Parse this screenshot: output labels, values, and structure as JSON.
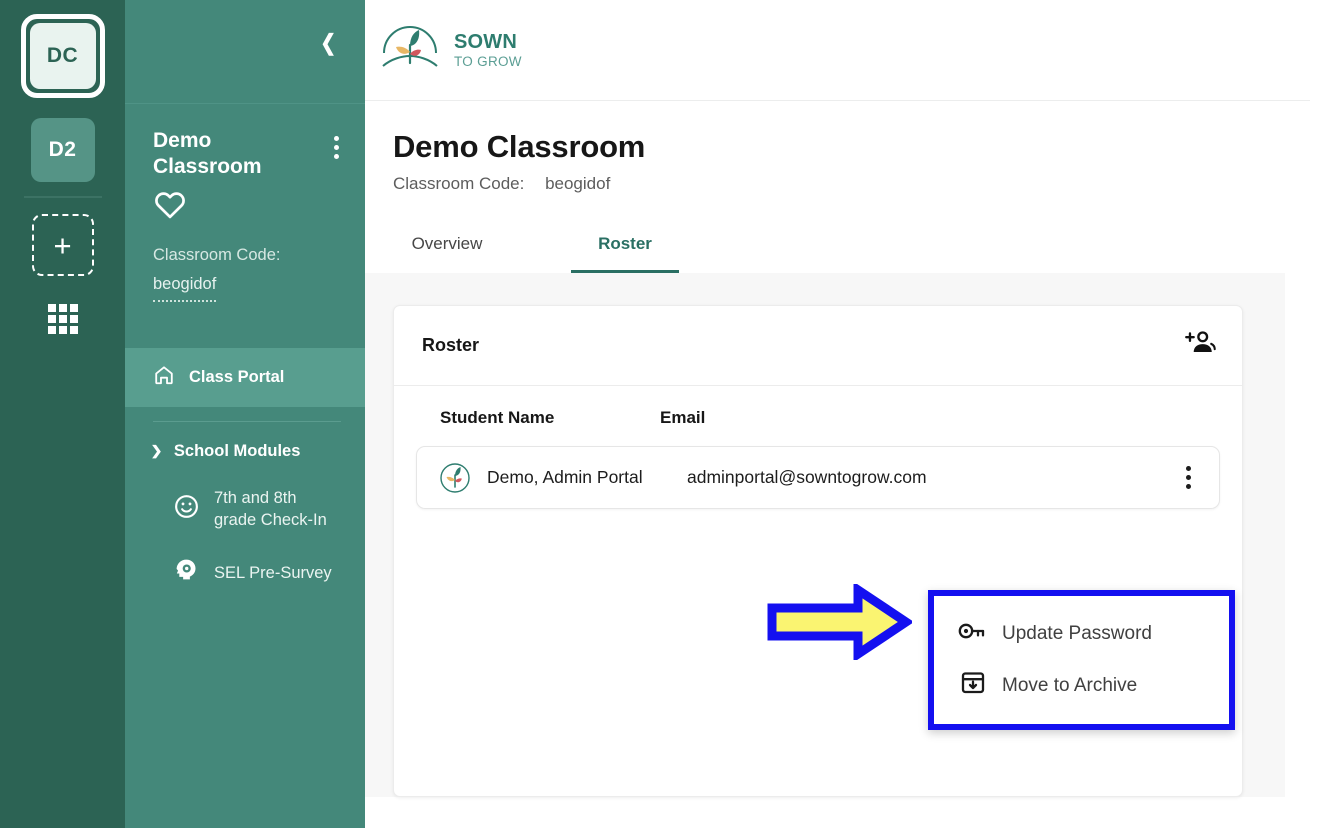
{
  "rail": {
    "avatar_primary": "DC",
    "avatar_secondary": "D2",
    "add_label": "+",
    "grid_icon": "grid-apps-icon"
  },
  "class_panel": {
    "collapse_icon": "chevron-left-icon",
    "title": "Demo Classroom",
    "kebab_icon": "kebab-menu-icon",
    "favorite_icon": "heart-outline-icon",
    "code_label": "Classroom Code:",
    "code_value": "beogidof",
    "nav": [
      {
        "label": "Class Portal",
        "icon": "home-icon",
        "active": true
      }
    ],
    "group": {
      "label": "School Modules",
      "icon": "chevron-down-icon",
      "expanded": true
    },
    "modules": [
      {
        "label": "7th and 8th grade Check-In",
        "icon": "smiley-face-icon"
      },
      {
        "label": "SEL Pre-Survey",
        "icon": "head-gear-icon"
      }
    ]
  },
  "topbar": {
    "logo_icon": "sown-to-grow-logo",
    "logo_line1": "SOWN",
    "logo_line2": "TO GROW"
  },
  "page": {
    "title": "Demo Classroom",
    "code_label": "Classroom Code:",
    "code_value": "beogidof",
    "tabs": [
      {
        "label": "Overview",
        "active": false
      },
      {
        "label": "Roster",
        "active": true
      }
    ]
  },
  "roster_card": {
    "title": "Roster",
    "add_student_icon": "add-person-icon",
    "columns": [
      "Student Name",
      "Email"
    ],
    "rows": [
      {
        "avatar_icon": "sown-to-grow-avatar",
        "name": "Demo, Admin Portal",
        "email": "adminportal@sowntogrow.com",
        "menu_icon": "kebab-menu-icon"
      }
    ]
  },
  "context_menu": {
    "items": [
      {
        "label": "Update Password",
        "icon": "key-icon"
      },
      {
        "label": "Move to Archive",
        "icon": "archive-down-icon"
      }
    ]
  },
  "annotation": {
    "arrow_icon": "yellow-right-arrow",
    "arrow_fill": "#FAF471",
    "arrow_stroke": "#1410F0",
    "highlight_stroke": "#1410F0"
  },
  "colors": {
    "rail_bg": "#2C6354",
    "panel_bg": "#44887A",
    "panel_active": "#589E8F",
    "accent_teal": "#2A6F63",
    "content_bg": "#F7F7F7"
  }
}
